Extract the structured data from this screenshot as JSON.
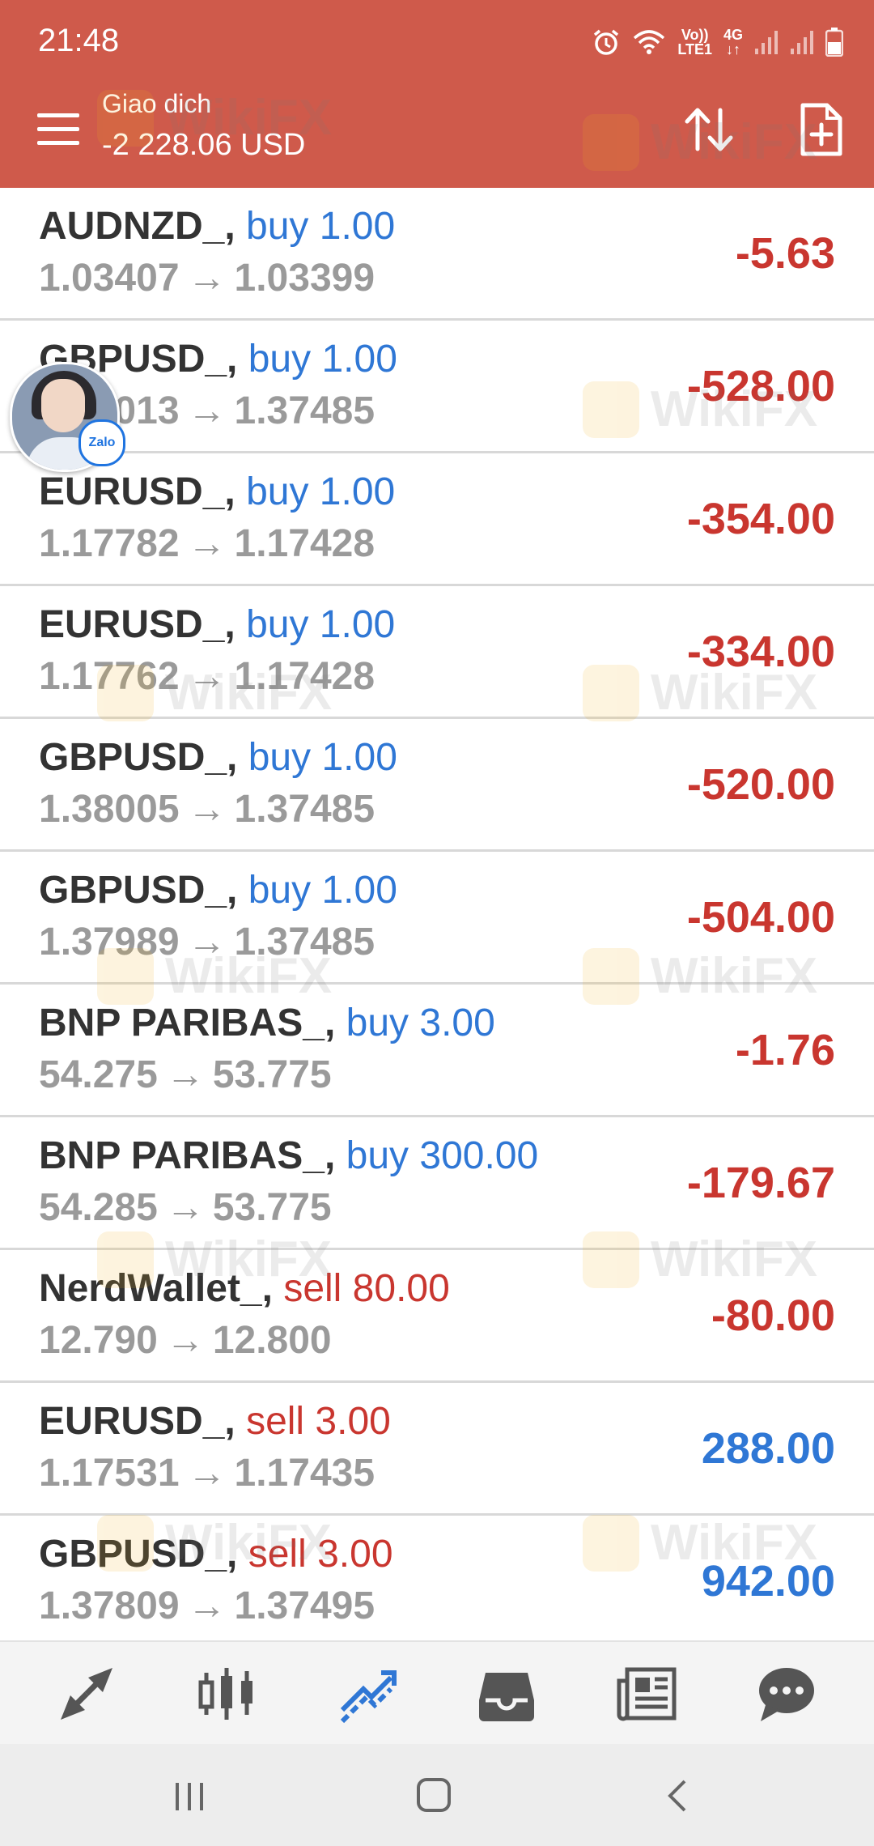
{
  "status_bar": {
    "time": "21:48",
    "volte_line1": "Vo))",
    "volte_line2": "LTE1",
    "net_label": "4G",
    "icons": [
      "alarm-icon",
      "wifi-icon",
      "volte-icon",
      "4g-icon",
      "signal-icon",
      "signal-icon",
      "battery-icon"
    ]
  },
  "header": {
    "title": "Giao dich",
    "balance": "-2 228.06 USD",
    "icons": [
      "menu-icon",
      "sort-icon",
      "new-document-icon"
    ]
  },
  "positions": [
    {
      "symbol": "AUDNZD_,",
      "type": "buy",
      "volume": "buy 1.00",
      "open": "1.03407",
      "current": "1.03399",
      "profit": "-5.63"
    },
    {
      "symbol": "GBPUSD_,",
      "type": "buy",
      "volume": "buy 1.00",
      "open": "1.38013",
      "current": "1.37485",
      "profit": "-528.00"
    },
    {
      "symbol": "EURUSD_,",
      "type": "buy",
      "volume": "buy 1.00",
      "open": "1.17782",
      "current": "1.17428",
      "profit": "-354.00"
    },
    {
      "symbol": "EURUSD_,",
      "type": "buy",
      "volume": "buy 1.00",
      "open": "1.17762",
      "current": "1.17428",
      "profit": "-334.00"
    },
    {
      "symbol": "GBPUSD_,",
      "type": "buy",
      "volume": "buy 1.00",
      "open": "1.38005",
      "current": "1.37485",
      "profit": "-520.00"
    },
    {
      "symbol": "GBPUSD_,",
      "type": "buy",
      "volume": "buy 1.00",
      "open": "1.37989",
      "current": "1.37485",
      "profit": "-504.00"
    },
    {
      "symbol": "BNP PARIBAS_,",
      "type": "buy",
      "volume": "buy 3.00",
      "open": "54.275",
      "current": "53.775",
      "profit": "-1.76"
    },
    {
      "symbol": "BNP PARIBAS_,",
      "type": "buy",
      "volume": "buy 300.00",
      "open": "54.285",
      "current": "53.775",
      "profit": "-179.67"
    },
    {
      "symbol": "NerdWallet_,",
      "type": "sell",
      "volume": "sell 80.00",
      "open": "12.790",
      "current": "12.800",
      "profit": "-80.00"
    },
    {
      "symbol": "EURUSD_,",
      "type": "sell",
      "volume": "sell 3.00",
      "open": "1.17531",
      "current": "1.17435",
      "profit": "288.00"
    },
    {
      "symbol": "GBPUSD_,",
      "type": "sell",
      "volume": "sell 3.00",
      "open": "1.37809",
      "current": "1.37495",
      "profit": "942.00"
    }
  ],
  "arrow_glyph": "→",
  "watermark": "WikiFX",
  "zalo": {
    "badge": "Zalo"
  },
  "bottom_nav": [
    {
      "name": "quotes-icon",
      "active": false
    },
    {
      "name": "chart-icon",
      "active": false
    },
    {
      "name": "trade-icon",
      "active": true
    },
    {
      "name": "history-icon",
      "active": false
    },
    {
      "name": "news-icon",
      "active": false
    },
    {
      "name": "chat-icon",
      "active": false
    }
  ],
  "system_nav": [
    "recents-icon",
    "home-icon",
    "back-icon"
  ],
  "colors": {
    "header": "#cf5a4b",
    "buy": "#2f77d5",
    "sell": "#c9362f",
    "loss": "#c9362f",
    "profit": "#2f77d5",
    "nav_active": "#2f77d5",
    "nav_inactive": "#555555"
  }
}
